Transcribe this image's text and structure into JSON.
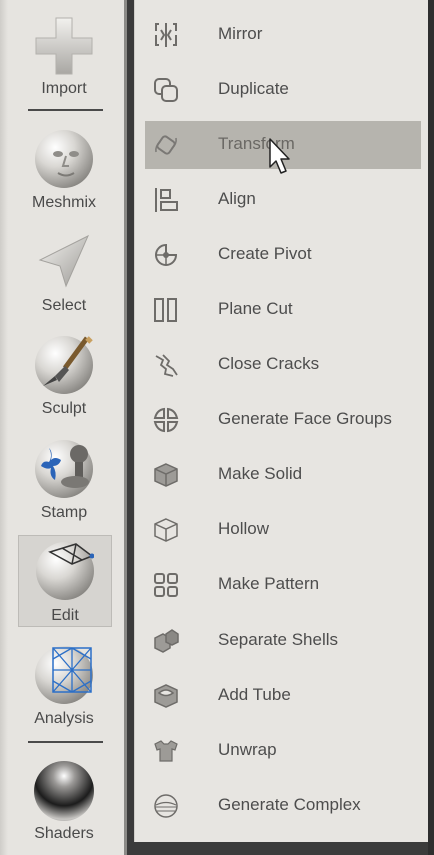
{
  "toolbar": {
    "tools": [
      {
        "label": "Import",
        "icon": "plus-icon"
      },
      {
        "label": "Meshmix",
        "icon": "meshmix-face-icon"
      },
      {
        "label": "Select",
        "icon": "arrow-cursor-icon"
      },
      {
        "label": "Sculpt",
        "icon": "brush-sphere-icon"
      },
      {
        "label": "Stamp",
        "icon": "stamp-sphere-icon"
      },
      {
        "label": "Edit",
        "icon": "edit-sphere-icon",
        "active": true
      },
      {
        "label": "Analysis",
        "icon": "analysis-mesh-icon"
      },
      {
        "label": "Shaders",
        "icon": "chrome-sphere-icon"
      }
    ]
  },
  "menu": {
    "highlighted": "Transform",
    "items": [
      {
        "label": "Mirror",
        "icon": "mirror-icon"
      },
      {
        "label": "Duplicate",
        "icon": "duplicate-icon"
      },
      {
        "label": "Transform",
        "icon": "transform-icon"
      },
      {
        "label": "Align",
        "icon": "align-icon"
      },
      {
        "label": "Create Pivot",
        "icon": "pivot-icon"
      },
      {
        "label": "Plane Cut",
        "icon": "plane-cut-icon"
      },
      {
        "label": "Close Cracks",
        "icon": "close-cracks-icon"
      },
      {
        "label": "Generate Face Groups",
        "icon": "face-groups-icon"
      },
      {
        "label": "Make Solid",
        "icon": "make-solid-icon"
      },
      {
        "label": "Hollow",
        "icon": "hollow-icon"
      },
      {
        "label": "Make Pattern",
        "icon": "make-pattern-icon"
      },
      {
        "label": "Separate Shells",
        "icon": "separate-shells-icon"
      },
      {
        "label": "Add Tube",
        "icon": "add-tube-icon"
      },
      {
        "label": "Unwrap",
        "icon": "unwrap-icon"
      },
      {
        "label": "Generate Complex",
        "icon": "generate-complex-icon"
      }
    ]
  }
}
